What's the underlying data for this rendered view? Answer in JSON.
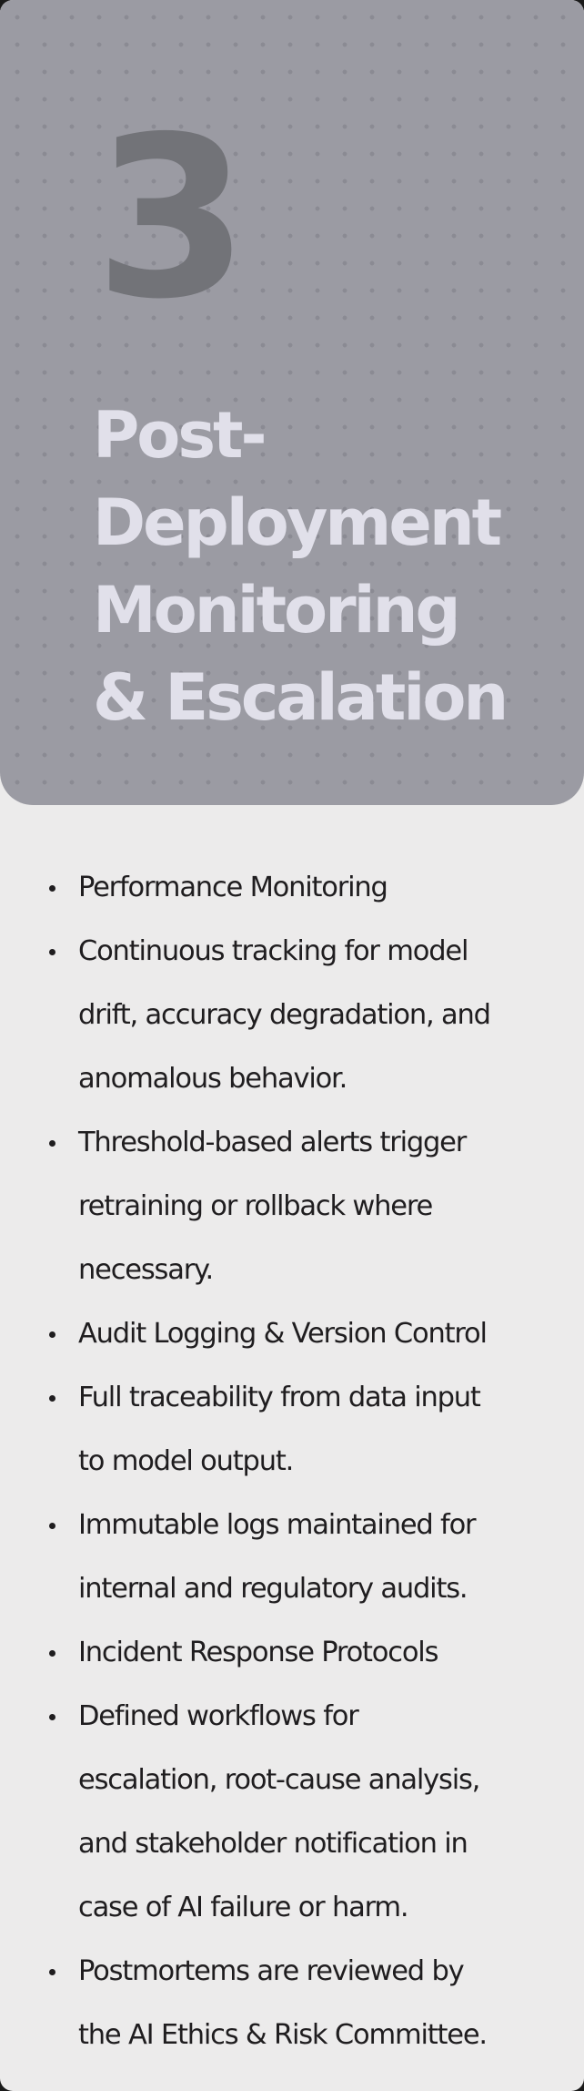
{
  "header": {
    "number": "3",
    "title_lines": [
      "Post-",
      "Deployment",
      "Monitoring",
      "& Escalation"
    ]
  },
  "items": [
    {
      "lines": [
        "Performance Monitoring"
      ]
    },
    {
      "lines": [
        "Continuous tracking for model",
        "drift, accuracy degradation, and",
        "anomalous behavior."
      ]
    },
    {
      "lines": [
        "Threshold-based alerts trigger",
        "retraining or rollback where",
        "necessary."
      ]
    },
    {
      "lines": [
        "Audit Logging & Version Control"
      ]
    },
    {
      "lines": [
        "Full traceability from data input",
        "to model output."
      ]
    },
    {
      "lines": [
        "Immutable logs maintained for",
        "internal and regulatory audits."
      ]
    },
    {
      "lines": [
        "Incident Response Protocols"
      ]
    },
    {
      "lines": [
        "Defined workflows for",
        "escalation, root-cause analysis,",
        "and stakeholder notification in",
        "case of AI failure or harm."
      ]
    },
    {
      "lines": [
        "Postmortems are reviewed by",
        "the AI Ethics & Risk Committee."
      ]
    }
  ]
}
